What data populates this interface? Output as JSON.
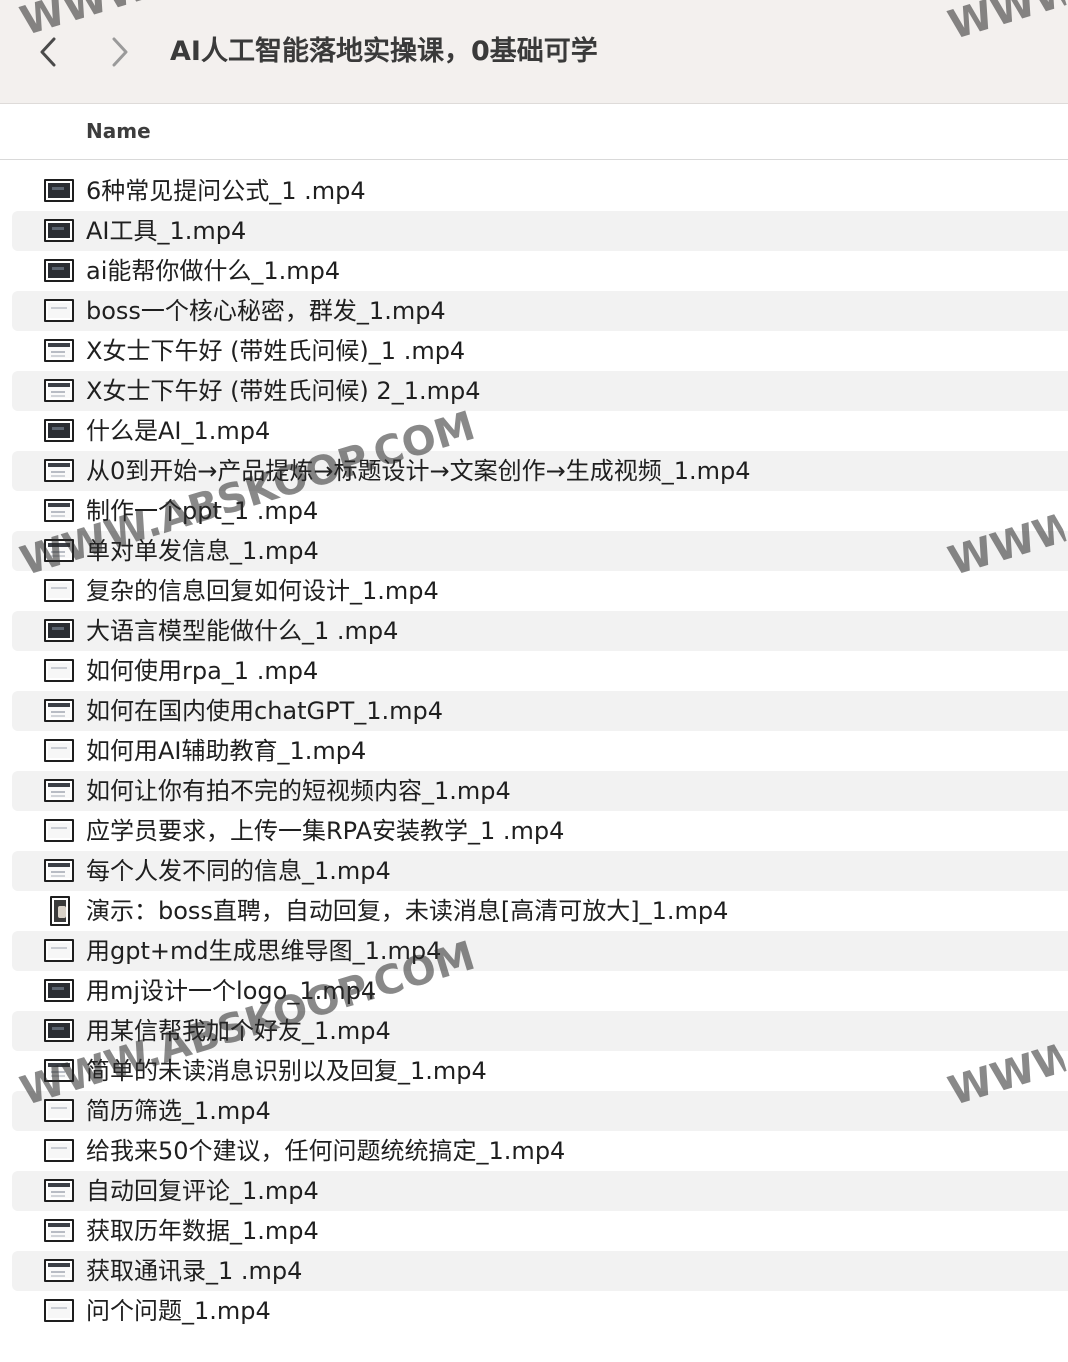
{
  "window": {
    "title": "AI人工智能落地实操课，0基础可学",
    "back_icon": "chevron-left-icon",
    "forward_icon": "chevron-right-icon"
  },
  "columns": {
    "name": "Name"
  },
  "files": [
    {
      "name": "6种常见提问公式_1 .mp4",
      "thumb": "dark"
    },
    {
      "name": "AI工具_1.mp4",
      "thumb": "dark"
    },
    {
      "name": "ai能帮你做什么_1.mp4",
      "thumb": "dark"
    },
    {
      "name": "boss一个核心秘密，群发_1.mp4",
      "thumb": "light"
    },
    {
      "name": "X女士下午好 (带姓氏问候)_1 .mp4",
      "thumb": "lines"
    },
    {
      "name": "X女士下午好 (带姓氏问候) 2_1.mp4",
      "thumb": "lines"
    },
    {
      "name": "什么是AI_1.mp4",
      "thumb": "dark"
    },
    {
      "name": "从0到开始→产品提炼→标题设计→文案创作→生成视频_1.mp4",
      "thumb": "lines"
    },
    {
      "name": "制作一个ppt_1 .mp4",
      "thumb": "lines"
    },
    {
      "name": "单对单发信息_1.mp4",
      "thumb": "lines"
    },
    {
      "name": "复杂的信息回复如何设计_1.mp4",
      "thumb": "light"
    },
    {
      "name": "大语言模型能做什么_1 .mp4",
      "thumb": "dark"
    },
    {
      "name": "如何使用rpa_1 .mp4",
      "thumb": "light"
    },
    {
      "name": "如何在国内使用chatGPT_1.mp4",
      "thumb": "lines"
    },
    {
      "name": "如何用AI辅助教育_1.mp4",
      "thumb": "light"
    },
    {
      "name": "如何让你有拍不完的短视频内容_1.mp4",
      "thumb": "lines"
    },
    {
      "name": "应学员要求，上传一集RPA安装教学_1 .mp4",
      "thumb": "light"
    },
    {
      "name": "每个人发不同的信息_1.mp4",
      "thumb": "lines"
    },
    {
      "name": "演示：boss直聘，自动回复，未读消息[高清可放大]_1.mp4",
      "thumb": "portrait"
    },
    {
      "name": "用gpt+md生成思维导图_1.mp4",
      "thumb": "light"
    },
    {
      "name": "用mj设计一个logo_1.mp4",
      "thumb": "dark"
    },
    {
      "name": "用某信帮我加个好友_1.mp4",
      "thumb": "dark"
    },
    {
      "name": "简单的未读消息识别以及回复_1.mp4",
      "thumb": "lines"
    },
    {
      "name": "简历筛选_1.mp4",
      "thumb": "light"
    },
    {
      "name": "给我来50个建议，任何问题统统搞定_1.mp4",
      "thumb": "light"
    },
    {
      "name": "自动回复评论_1.mp4",
      "thumb": "lines"
    },
    {
      "name": "获取历年数据_1.mp4",
      "thumb": "lines"
    },
    {
      "name": "获取通讯录_1 .mp4",
      "thumb": "lines"
    },
    {
      "name": "问个问题_1.mp4",
      "thumb": "light"
    }
  ],
  "watermarks": [
    {
      "text": "WWW.ABSKOOP.COM"
    },
    {
      "text": "WWW.ABSKOOP.COM"
    },
    {
      "text": "WWW"
    },
    {
      "text": "WWW"
    },
    {
      "text": "WWW"
    },
    {
      "text": "WWW"
    }
  ]
}
